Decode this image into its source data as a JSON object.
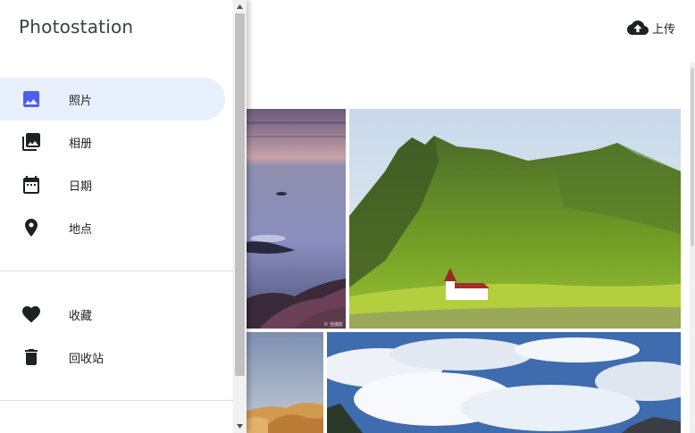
{
  "app": {
    "title": "Photostation"
  },
  "header": {
    "upload_label": "上传",
    "upload_icon": "cloud-upload-icon"
  },
  "nav": {
    "primary": [
      {
        "label": "照片",
        "icon": "photo-icon",
        "active": true
      },
      {
        "label": "相册",
        "icon": "photo-library-icon",
        "active": false
      },
      {
        "label": "日期",
        "icon": "calendar-icon",
        "active": false
      },
      {
        "label": "地点",
        "icon": "location-pin-icon",
        "active": false
      }
    ],
    "secondary": [
      {
        "label": "收藏",
        "icon": "heart-icon",
        "active": false
      },
      {
        "label": "回收站",
        "icon": "trash-icon",
        "active": false
      }
    ]
  },
  "colors": {
    "accent": "#4e5ff0",
    "active_bg": "#e8f0fe",
    "text": "#202124"
  },
  "photos": [
    {
      "description": "seascape-at-dusk",
      "watermark": "© 佳摄影"
    },
    {
      "description": "green-mountain-with-white-church",
      "watermark": ""
    },
    {
      "description": "desert-dunes",
      "watermark": ""
    },
    {
      "description": "cloudy-sky-over-mountains",
      "watermark": ""
    }
  ]
}
